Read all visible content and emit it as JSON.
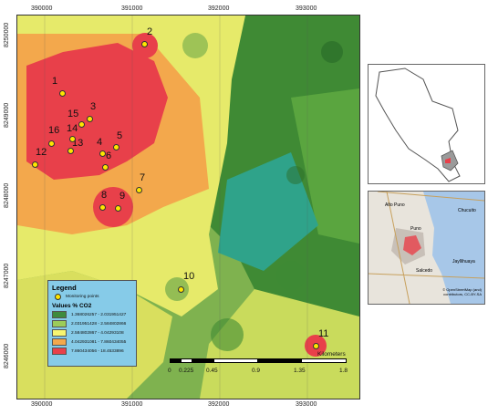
{
  "map": {
    "x_ticks": [
      "390000",
      "391000",
      "392000",
      "393000"
    ],
    "y_ticks": [
      "8250000",
      "8249000",
      "8248000",
      "8247000",
      "8246000"
    ],
    "monitoring_points": [
      "1",
      "2",
      "3",
      "4",
      "5",
      "6",
      "7",
      "8",
      "9",
      "10",
      "11",
      "12",
      "13",
      "14",
      "15",
      "16"
    ]
  },
  "legend": {
    "title": "Legend",
    "points_label": "Monitoring points",
    "values_title": "Values % CO2",
    "classes": [
      {
        "label": "1.368026257 - 2.031951427",
        "color": "#3e8b3e"
      },
      {
        "label": "2.031951428 - 2.584802866",
        "color": "#9ccc5a"
      },
      {
        "label": "2.584802867 - 4.04293108",
        "color": "#f7f570"
      },
      {
        "label": "4.042931081 - 7.860434055",
        "color": "#f3a84c"
      },
      {
        "label": "7.860434056 - 18.4533896",
        "color": "#e8404a"
      }
    ]
  },
  "scale": {
    "ticks": [
      "0",
      "0.225",
      "0.45",
      "0.9",
      "1.35",
      "1.8"
    ],
    "unit": "Kilometers"
  },
  "inset_lower": {
    "labels": [
      "Alto Puno",
      "Chucuito",
      "Puno",
      "Salcedo",
      "Jayllihuaya"
    ],
    "attribution": "© OpenStreetMap (and) contributors, CC-BY-SA"
  }
}
